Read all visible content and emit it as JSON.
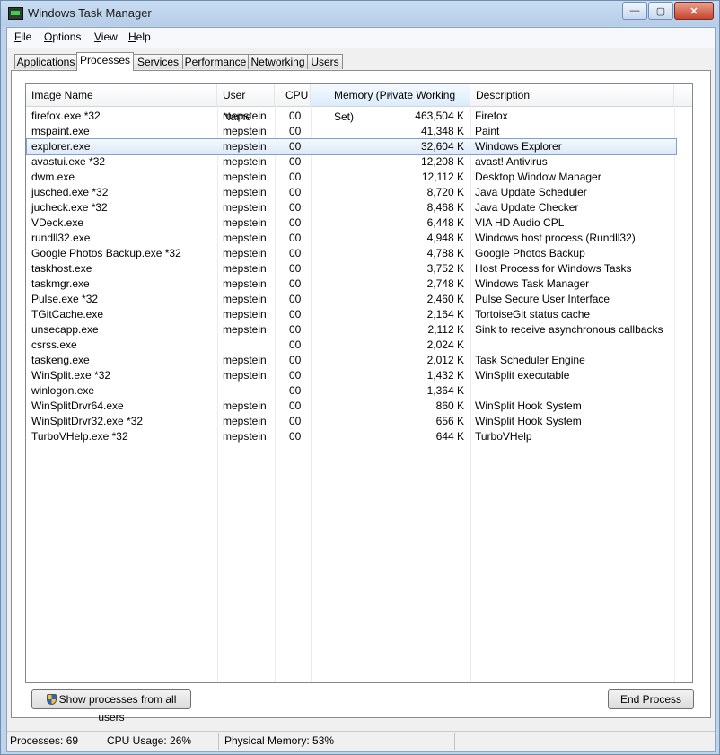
{
  "window": {
    "title": "Windows Task Manager",
    "controls": {
      "minimize": "—",
      "maximize": "▢",
      "close": "✕"
    }
  },
  "menu": [
    {
      "first": "F",
      "rest": "ile"
    },
    {
      "first": "O",
      "rest": "ptions"
    },
    {
      "first": "V",
      "rest": "iew"
    },
    {
      "first": "H",
      "rest": "elp"
    }
  ],
  "tabs": [
    "Applications",
    "Processes",
    "Services",
    "Performance",
    "Networking",
    "Users"
  ],
  "active_tab": "Processes",
  "columns": [
    "Image Name",
    "User Name",
    "CPU",
    "Memory (Private Working Set)",
    "Description"
  ],
  "processes": [
    {
      "name": "firefox.exe *32",
      "user": "mepstein",
      "cpu": "00",
      "mem": "463,504 K",
      "desc": "Firefox"
    },
    {
      "name": "mspaint.exe",
      "user": "mepstein",
      "cpu": "00",
      "mem": "41,348 K",
      "desc": "Paint"
    },
    {
      "name": "explorer.exe",
      "user": "mepstein",
      "cpu": "00",
      "mem": "32,604 K",
      "desc": "Windows Explorer"
    },
    {
      "name": "avastui.exe *32",
      "user": "mepstein",
      "cpu": "00",
      "mem": "12,208 K",
      "desc": "avast! Antivirus"
    },
    {
      "name": "dwm.exe",
      "user": "mepstein",
      "cpu": "00",
      "mem": "12,112 K",
      "desc": "Desktop Window Manager"
    },
    {
      "name": "jusched.exe *32",
      "user": "mepstein",
      "cpu": "00",
      "mem": "8,720 K",
      "desc": "Java Update Scheduler"
    },
    {
      "name": "jucheck.exe *32",
      "user": "mepstein",
      "cpu": "00",
      "mem": "8,468 K",
      "desc": "Java Update Checker"
    },
    {
      "name": "VDeck.exe",
      "user": "mepstein",
      "cpu": "00",
      "mem": "6,448 K",
      "desc": "VIA HD Audio CPL"
    },
    {
      "name": "rundll32.exe",
      "user": "mepstein",
      "cpu": "00",
      "mem": "4,948 K",
      "desc": "Windows host process (Rundll32)"
    },
    {
      "name": "Google Photos Backup.exe *32",
      "user": "mepstein",
      "cpu": "00",
      "mem": "4,788 K",
      "desc": "Google Photos Backup"
    },
    {
      "name": "taskhost.exe",
      "user": "mepstein",
      "cpu": "00",
      "mem": "3,752 K",
      "desc": "Host Process for Windows Tasks"
    },
    {
      "name": "taskmgr.exe",
      "user": "mepstein",
      "cpu": "00",
      "mem": "2,748 K",
      "desc": "Windows Task Manager"
    },
    {
      "name": "Pulse.exe *32",
      "user": "mepstein",
      "cpu": "00",
      "mem": "2,460 K",
      "desc": "Pulse Secure User Interface"
    },
    {
      "name": "TGitCache.exe",
      "user": "mepstein",
      "cpu": "00",
      "mem": "2,164 K",
      "desc": "TortoiseGit status cache"
    },
    {
      "name": "unsecapp.exe",
      "user": "mepstein",
      "cpu": "00",
      "mem": "2,112 K",
      "desc": "Sink to receive asynchronous callbacks fo..."
    },
    {
      "name": "csrss.exe",
      "user": "",
      "cpu": "00",
      "mem": "2,024 K",
      "desc": ""
    },
    {
      "name": "taskeng.exe",
      "user": "mepstein",
      "cpu": "00",
      "mem": "2,012 K",
      "desc": "Task Scheduler Engine"
    },
    {
      "name": "WinSplit.exe *32",
      "user": "mepstein",
      "cpu": "00",
      "mem": "1,432 K",
      "desc": "WinSplit executable"
    },
    {
      "name": "winlogon.exe",
      "user": "",
      "cpu": "00",
      "mem": "1,364 K",
      "desc": ""
    },
    {
      "name": "WinSplitDrvr64.exe",
      "user": "mepstein",
      "cpu": "00",
      "mem": "860 K",
      "desc": "WinSplit Hook System"
    },
    {
      "name": "WinSplitDrvr32.exe *32",
      "user": "mepstein",
      "cpu": "00",
      "mem": "656 K",
      "desc": "WinSplit Hook System"
    },
    {
      "name": "TurboVHelp.exe *32",
      "user": "mepstein",
      "cpu": "00",
      "mem": "644 K",
      "desc": "TurboVHelp"
    }
  ],
  "selected_process": "explorer.exe",
  "buttons": {
    "show_all": "Show processes from all users",
    "end_process": "End Process"
  },
  "status": {
    "processes": "Processes: 69",
    "cpu": "CPU Usage: 26%",
    "memory": "Physical Memory: 53%"
  }
}
